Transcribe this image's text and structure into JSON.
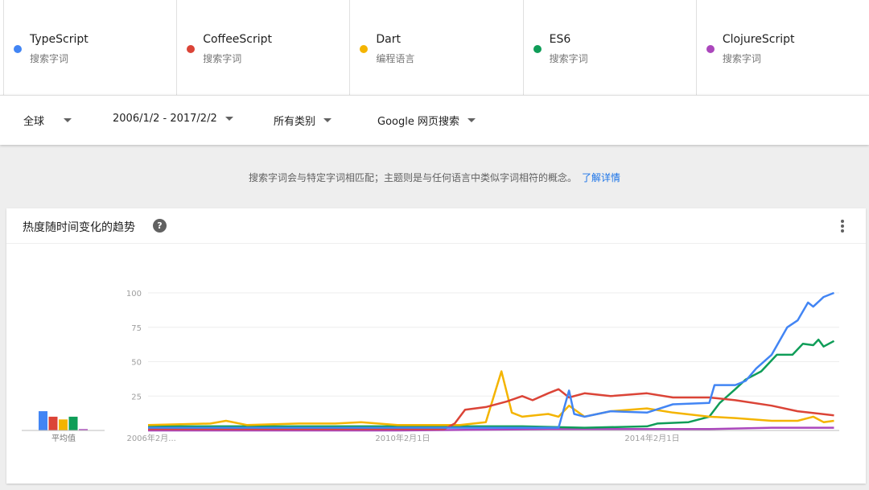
{
  "terms": [
    {
      "name": "TypeScript",
      "sub": "搜索字词",
      "color": "#4285f4"
    },
    {
      "name": "CoffeeScript",
      "sub": "搜索字词",
      "color": "#db4437"
    },
    {
      "name": "Dart",
      "sub": "编程语言",
      "color": "#f4b400"
    },
    {
      "name": "ES6",
      "sub": "搜索字词",
      "color": "#0f9d58"
    },
    {
      "name": "ClojureScript",
      "sub": "搜索字词",
      "color": "#ab47bc"
    }
  ],
  "filters": {
    "region": "全球",
    "date_range": "2006/1/2 - 2017/2/2",
    "category": "所有类别",
    "property": "Google 网页搜索"
  },
  "notice": {
    "text": "搜索字词会与特定字词相匹配；主题则是与任何语言中类似字词相符的概念。",
    "link": "了解详情"
  },
  "card": {
    "title": "热度随时间变化的趋势",
    "help_icon": "help-icon",
    "menu_icon": "more-vert-icon"
  },
  "chart_data": {
    "type": "line",
    "title": "热度随时间变化的趋势",
    "xlabel": "",
    "ylabel": "",
    "ylim": [
      0,
      100
    ],
    "yticks": [
      25,
      50,
      75,
      100
    ],
    "grid": true,
    "x_tick_labels": [
      "2006年2月...",
      "2010年2月1日",
      "2014年2月1日"
    ],
    "x_tick_dates": [
      "2006-02",
      "2010-02",
      "2014-02"
    ],
    "x_range": [
      "2006-01",
      "2017-02"
    ],
    "average_label": "平均值",
    "averages": [
      {
        "name": "TypeScript",
        "value": 14
      },
      {
        "name": "CoffeeScript",
        "value": 10
      },
      {
        "name": "Dart",
        "value": 8
      },
      {
        "name": "ES6",
        "value": 10
      },
      {
        "name": "ClojureScript",
        "value": 1
      }
    ],
    "series": [
      {
        "name": "TypeScript",
        "color": "#4285f4",
        "points": [
          [
            "2006-01",
            2
          ],
          [
            "2008-01",
            2
          ],
          [
            "2010-01",
            2
          ],
          [
            "2012-01",
            2
          ],
          [
            "2012-08",
            2
          ],
          [
            "2012-10",
            29
          ],
          [
            "2012-11",
            12
          ],
          [
            "2013-01",
            10
          ],
          [
            "2013-06",
            14
          ],
          [
            "2014-01",
            13
          ],
          [
            "2014-06",
            19
          ],
          [
            "2015-01",
            20
          ],
          [
            "2015-02",
            33
          ],
          [
            "2015-06",
            33
          ],
          [
            "2015-08",
            36
          ],
          [
            "2015-10",
            45
          ],
          [
            "2016-01",
            55
          ],
          [
            "2016-04",
            75
          ],
          [
            "2016-06",
            80
          ],
          [
            "2016-08",
            93
          ],
          [
            "2016-09",
            90
          ],
          [
            "2016-11",
            97
          ],
          [
            "2017-01",
            100
          ]
        ]
      },
      {
        "name": "CoffeeScript",
        "color": "#db4437",
        "points": [
          [
            "2006-01",
            1
          ],
          [
            "2008-01",
            1
          ],
          [
            "2010-01",
            1
          ],
          [
            "2010-10",
            1
          ],
          [
            "2010-12",
            5
          ],
          [
            "2011-02",
            15
          ],
          [
            "2011-06",
            17
          ],
          [
            "2011-10",
            21
          ],
          [
            "2012-01",
            25
          ],
          [
            "2012-03",
            22
          ],
          [
            "2012-06",
            27
          ],
          [
            "2012-08",
            30
          ],
          [
            "2012-10",
            24
          ],
          [
            "2013-01",
            27
          ],
          [
            "2013-06",
            25
          ],
          [
            "2014-01",
            27
          ],
          [
            "2014-06",
            24
          ],
          [
            "2015-01",
            24
          ],
          [
            "2015-06",
            22
          ],
          [
            "2016-01",
            18
          ],
          [
            "2016-06",
            14
          ],
          [
            "2017-01",
            11
          ]
        ]
      },
      {
        "name": "Dart",
        "color": "#f4b400",
        "points": [
          [
            "2006-01",
            4
          ],
          [
            "2007-01",
            5
          ],
          [
            "2007-04",
            7
          ],
          [
            "2007-08",
            4
          ],
          [
            "2008-06",
            5
          ],
          [
            "2009-01",
            5
          ],
          [
            "2009-06",
            6
          ],
          [
            "2010-01",
            4
          ],
          [
            "2011-01",
            4
          ],
          [
            "2011-06",
            6
          ],
          [
            "2011-09",
            43
          ],
          [
            "2011-11",
            13
          ],
          [
            "2012-01",
            10
          ],
          [
            "2012-06",
            12
          ],
          [
            "2012-08",
            10
          ],
          [
            "2012-10",
            18
          ],
          [
            "2013-01",
            10
          ],
          [
            "2013-06",
            14
          ],
          [
            "2014-01",
            16
          ],
          [
            "2014-06",
            13
          ],
          [
            "2015-01",
            10
          ],
          [
            "2015-06",
            9
          ],
          [
            "2016-01",
            7
          ],
          [
            "2016-06",
            7
          ],
          [
            "2016-09",
            10
          ],
          [
            "2016-11",
            6
          ],
          [
            "2017-01",
            7
          ]
        ]
      },
      {
        "name": "ES6",
        "color": "#0f9d58",
        "points": [
          [
            "2006-01",
            3
          ],
          [
            "2008-01",
            3
          ],
          [
            "2010-01",
            3
          ],
          [
            "2012-01",
            3
          ],
          [
            "2013-01",
            2
          ],
          [
            "2014-01",
            3
          ],
          [
            "2014-03",
            5
          ],
          [
            "2014-09",
            6
          ],
          [
            "2015-01",
            10
          ],
          [
            "2015-03",
            20
          ],
          [
            "2015-06",
            30
          ],
          [
            "2015-08",
            37
          ],
          [
            "2015-11",
            43
          ],
          [
            "2016-02",
            55
          ],
          [
            "2016-05",
            55
          ],
          [
            "2016-07",
            63
          ],
          [
            "2016-09",
            62
          ],
          [
            "2016-10",
            66
          ],
          [
            "2016-11",
            61
          ],
          [
            "2017-01",
            65
          ]
        ]
      },
      {
        "name": "ClojureScript",
        "color": "#ab47bc",
        "points": [
          [
            "2006-01",
            0
          ],
          [
            "2010-01",
            0
          ],
          [
            "2012-06",
            1
          ],
          [
            "2014-01",
            1
          ],
          [
            "2015-01",
            1
          ],
          [
            "2016-01",
            2
          ],
          [
            "2017-01",
            2
          ]
        ]
      }
    ]
  }
}
